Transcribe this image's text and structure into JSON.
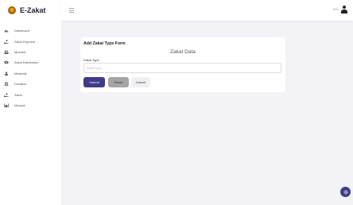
{
  "app": {
    "brand_name": "E-Zakat"
  },
  "topbar": {
    "user_label": "ADi"
  },
  "sidebar": {
    "items": [
      {
        "label": "Dashboard",
        "icon": "dashboard-icon"
      },
      {
        "label": "Zakat Payment",
        "icon": "hand-coin-icon",
        "has_submenu": true
      },
      {
        "label": "Muzzaki",
        "icon": "users-icon"
      },
      {
        "label": "Zakat Distribution",
        "icon": "eye-icon"
      },
      {
        "label": "Mustahik",
        "icon": "user-icon"
      },
      {
        "label": "Donation",
        "icon": "bank-icon"
      },
      {
        "label": "Zakat",
        "icon": "hand-coin-icon"
      },
      {
        "label": "Mosque",
        "icon": "mosque-icon"
      }
    ]
  },
  "form": {
    "title": "Add Zakat Type Form",
    "subtitle": "Zakat Data",
    "field_label": "Zakat Type",
    "field_placeholder": "Zakat Type",
    "field_value": "",
    "submit_label": "Submit",
    "reset_label": "Reset",
    "cancel_label": "Cancel"
  },
  "colors": {
    "accent": "#3f3b8c",
    "background": "#f2f2f7",
    "reset_button": "#a5a5a5"
  }
}
